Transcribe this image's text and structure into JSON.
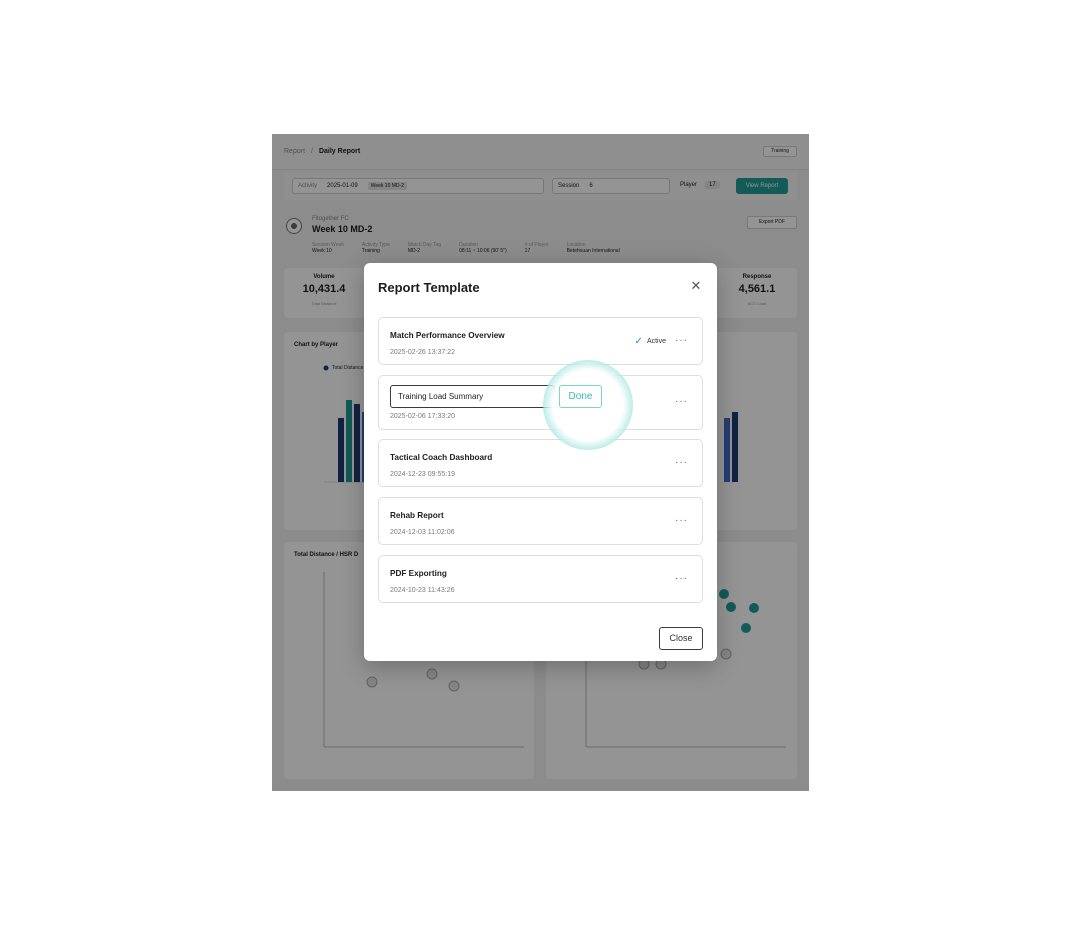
{
  "app": {
    "breadcrumb": {
      "parent": "Report",
      "separator": "/",
      "current": "Daily Report"
    },
    "training_button": "Training",
    "filters": {
      "activity_label": "Activity",
      "activity_date": "2025-01-09",
      "activity_tag": "Week 10 MD-2",
      "session_label": "Session",
      "session_value": "6",
      "players_label": "Player",
      "players_count": "17",
      "view_report": "View Report"
    },
    "header": {
      "club": "Fitogether FC",
      "title": "Week 10 MD-2",
      "export": "Export PDF",
      "meta": [
        {
          "label": "Session Week",
          "value": "Week 10"
        },
        {
          "label": "Activity Type",
          "value": "Training"
        },
        {
          "label": "Match Day Tag",
          "value": "MD-2"
        },
        {
          "label": "Duration",
          "value": "08:11 ~ 10:06 (90' 5\")"
        },
        {
          "label": "# of Player",
          "value": "17"
        },
        {
          "label": "Location",
          "value": "Betehouan International"
        }
      ]
    },
    "kpis": [
      {
        "title": "Volume",
        "value": "10,431.4",
        "sub": "Total Distance"
      },
      {
        "title": "Response",
        "value": "4,561.1",
        "sub": "ACC Load"
      }
    ],
    "cards": {
      "chart_by_player": "Chart by Player",
      "legend_total": "Total Distance",
      "distance_card": "Total Distance / HSR D"
    }
  },
  "modal": {
    "title": "Report Template",
    "items": [
      {
        "name": "Match Performance Overview",
        "date": "2025-02-26 13:37:22",
        "badge": "Active"
      },
      {
        "name": "Training Load Summary",
        "date": "2025-02-06 17:33:20"
      },
      {
        "name": "Tactical Coach Dashboard",
        "date": "2024-12-23 09:55:19"
      },
      {
        "name": "Rehab Report",
        "date": "2024-12-03 11:02:06"
      },
      {
        "name": "PDF Exporting",
        "date": "2024-10-23 11:43:26"
      }
    ],
    "done_label": "Done",
    "close_label": "Close",
    "more_glyph": "···"
  },
  "colors": {
    "accent": "#1f9e96",
    "navy": "#1f3b73",
    "blue": "#3f6bc6"
  }
}
